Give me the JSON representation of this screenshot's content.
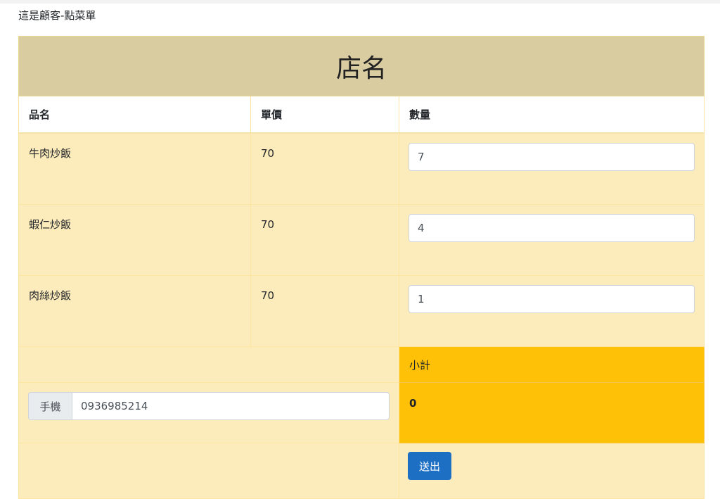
{
  "page": {
    "heading": "這是顧客-點菜單"
  },
  "shop": {
    "name": "店名"
  },
  "table": {
    "headers": {
      "name": "品名",
      "price": "單價",
      "quantity": "數量"
    },
    "items": [
      {
        "name": "牛肉炒飯",
        "price": "70",
        "quantity": "7"
      },
      {
        "name": "蝦仁炒飯",
        "price": "70",
        "quantity": "4"
      },
      {
        "name": "肉絲炒飯",
        "price": "70",
        "quantity": "1"
      }
    ]
  },
  "summary": {
    "subtotal_label": "小計",
    "subtotal_value": "0"
  },
  "phone": {
    "label": "手機",
    "value": "0936985214"
  },
  "actions": {
    "submit_label": "送出"
  },
  "colors": {
    "header_bg": "#d9cca1",
    "row_bg": "#fdecbb",
    "warning": "#ffc107",
    "primary": "#1d6fc4"
  }
}
